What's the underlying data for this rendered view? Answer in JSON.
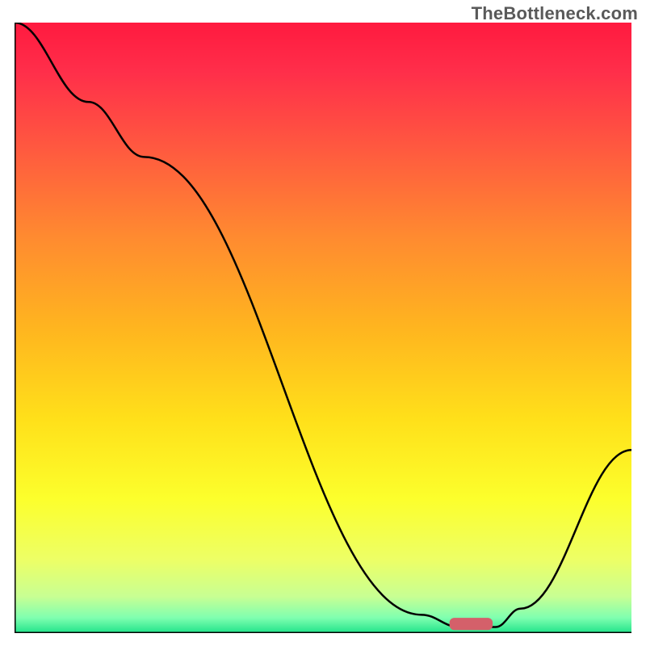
{
  "watermark": "TheBottleneck.com",
  "chart_data": {
    "type": "line",
    "title": "",
    "xlabel": "",
    "ylabel": "",
    "xlim": [
      0,
      100
    ],
    "ylim": [
      0,
      100
    ],
    "grid": false,
    "legend": false,
    "background_gradient": {
      "stops": [
        {
          "offset": 0.0,
          "color": "#ff1a3f"
        },
        {
          "offset": 0.08,
          "color": "#ff2e4a"
        },
        {
          "offset": 0.2,
          "color": "#ff5740"
        },
        {
          "offset": 0.35,
          "color": "#ff8a30"
        },
        {
          "offset": 0.5,
          "color": "#ffb51f"
        },
        {
          "offset": 0.65,
          "color": "#ffe01a"
        },
        {
          "offset": 0.78,
          "color": "#fcff2c"
        },
        {
          "offset": 0.88,
          "color": "#edff66"
        },
        {
          "offset": 0.94,
          "color": "#c8ff93"
        },
        {
          "offset": 0.975,
          "color": "#7fffb0"
        },
        {
          "offset": 1.0,
          "color": "#20e38a"
        }
      ]
    },
    "series": [
      {
        "name": "bottleneck-curve",
        "color": "#000000",
        "x": [
          0,
          12,
          21,
          66,
          72,
          78,
          82,
          100
        ],
        "y": [
          100,
          87,
          78,
          3,
          1,
          1,
          4,
          30
        ]
      }
    ],
    "marker": {
      "name": "optimum-marker",
      "x": 74,
      "y": 1.5,
      "color": "#d4606a",
      "width": 7,
      "height": 2
    },
    "axes": {
      "draw_left": true,
      "draw_bottom": true,
      "stroke": "#000000",
      "stroke_width": 3
    }
  }
}
